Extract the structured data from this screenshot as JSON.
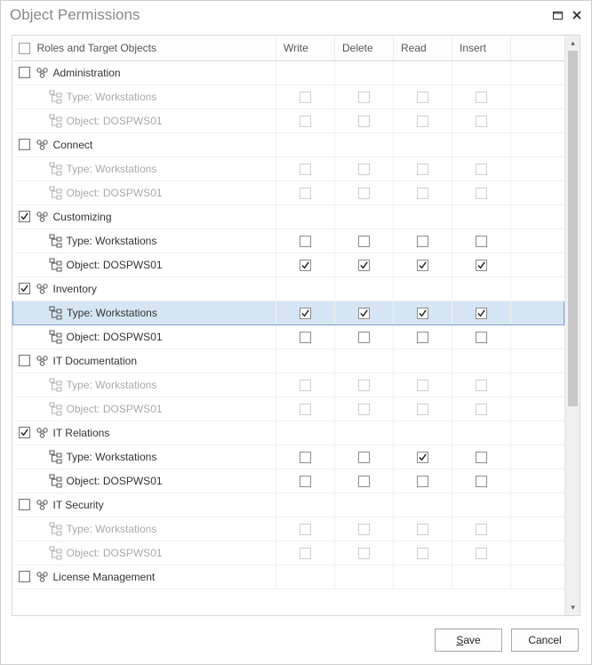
{
  "dialog": {
    "title": "Object Permissions"
  },
  "columns": {
    "tree": "Roles and Target Objects",
    "write": "Write",
    "delete": "Delete",
    "read": "Read",
    "insert": "Insert"
  },
  "labels": {
    "type_prefix": "Type: ",
    "object_prefix": "Object: ",
    "type_value": "Workstations",
    "object_value": "DOSPWS01"
  },
  "roles": [
    {
      "name": "Administration",
      "checked": false,
      "dim": true,
      "selected": false,
      "type_perms": {
        "write": false,
        "delete": false,
        "read": false,
        "insert": false
      },
      "obj_perms": {
        "write": false,
        "delete": false,
        "read": false,
        "insert": false
      }
    },
    {
      "name": "Connect",
      "checked": false,
      "dim": true,
      "selected": false,
      "type_perms": {
        "write": false,
        "delete": false,
        "read": false,
        "insert": false
      },
      "obj_perms": {
        "write": false,
        "delete": false,
        "read": false,
        "insert": false
      }
    },
    {
      "name": "Customizing",
      "checked": true,
      "dim": false,
      "selected": false,
      "type_perms": {
        "write": false,
        "delete": false,
        "read": false,
        "insert": false
      },
      "obj_perms": {
        "write": true,
        "delete": true,
        "read": true,
        "insert": true
      }
    },
    {
      "name": "Inventory",
      "checked": true,
      "dim": false,
      "selected": true,
      "type_perms": {
        "write": true,
        "delete": true,
        "read": true,
        "insert": true
      },
      "obj_perms": {
        "write": false,
        "delete": false,
        "read": false,
        "insert": false
      }
    },
    {
      "name": "IT Documentation",
      "checked": false,
      "dim": true,
      "selected": false,
      "type_perms": {
        "write": false,
        "delete": false,
        "read": false,
        "insert": false
      },
      "obj_perms": {
        "write": false,
        "delete": false,
        "read": false,
        "insert": false
      }
    },
    {
      "name": "IT Relations",
      "checked": true,
      "dim": false,
      "selected": false,
      "type_perms": {
        "write": false,
        "delete": false,
        "read": true,
        "insert": false
      },
      "obj_perms": {
        "write": false,
        "delete": false,
        "read": false,
        "insert": false
      }
    },
    {
      "name": "IT Security",
      "checked": false,
      "dim": true,
      "selected": false,
      "type_perms": {
        "write": false,
        "delete": false,
        "read": false,
        "insert": false
      },
      "obj_perms": {
        "write": false,
        "delete": false,
        "read": false,
        "insert": false
      }
    },
    {
      "name": "License Management",
      "checked": false,
      "dim": true,
      "selected": false,
      "type_perms": null,
      "obj_perms": null
    }
  ],
  "buttons": {
    "save": "Save",
    "save_accel": "S",
    "cancel": "Cancel"
  }
}
